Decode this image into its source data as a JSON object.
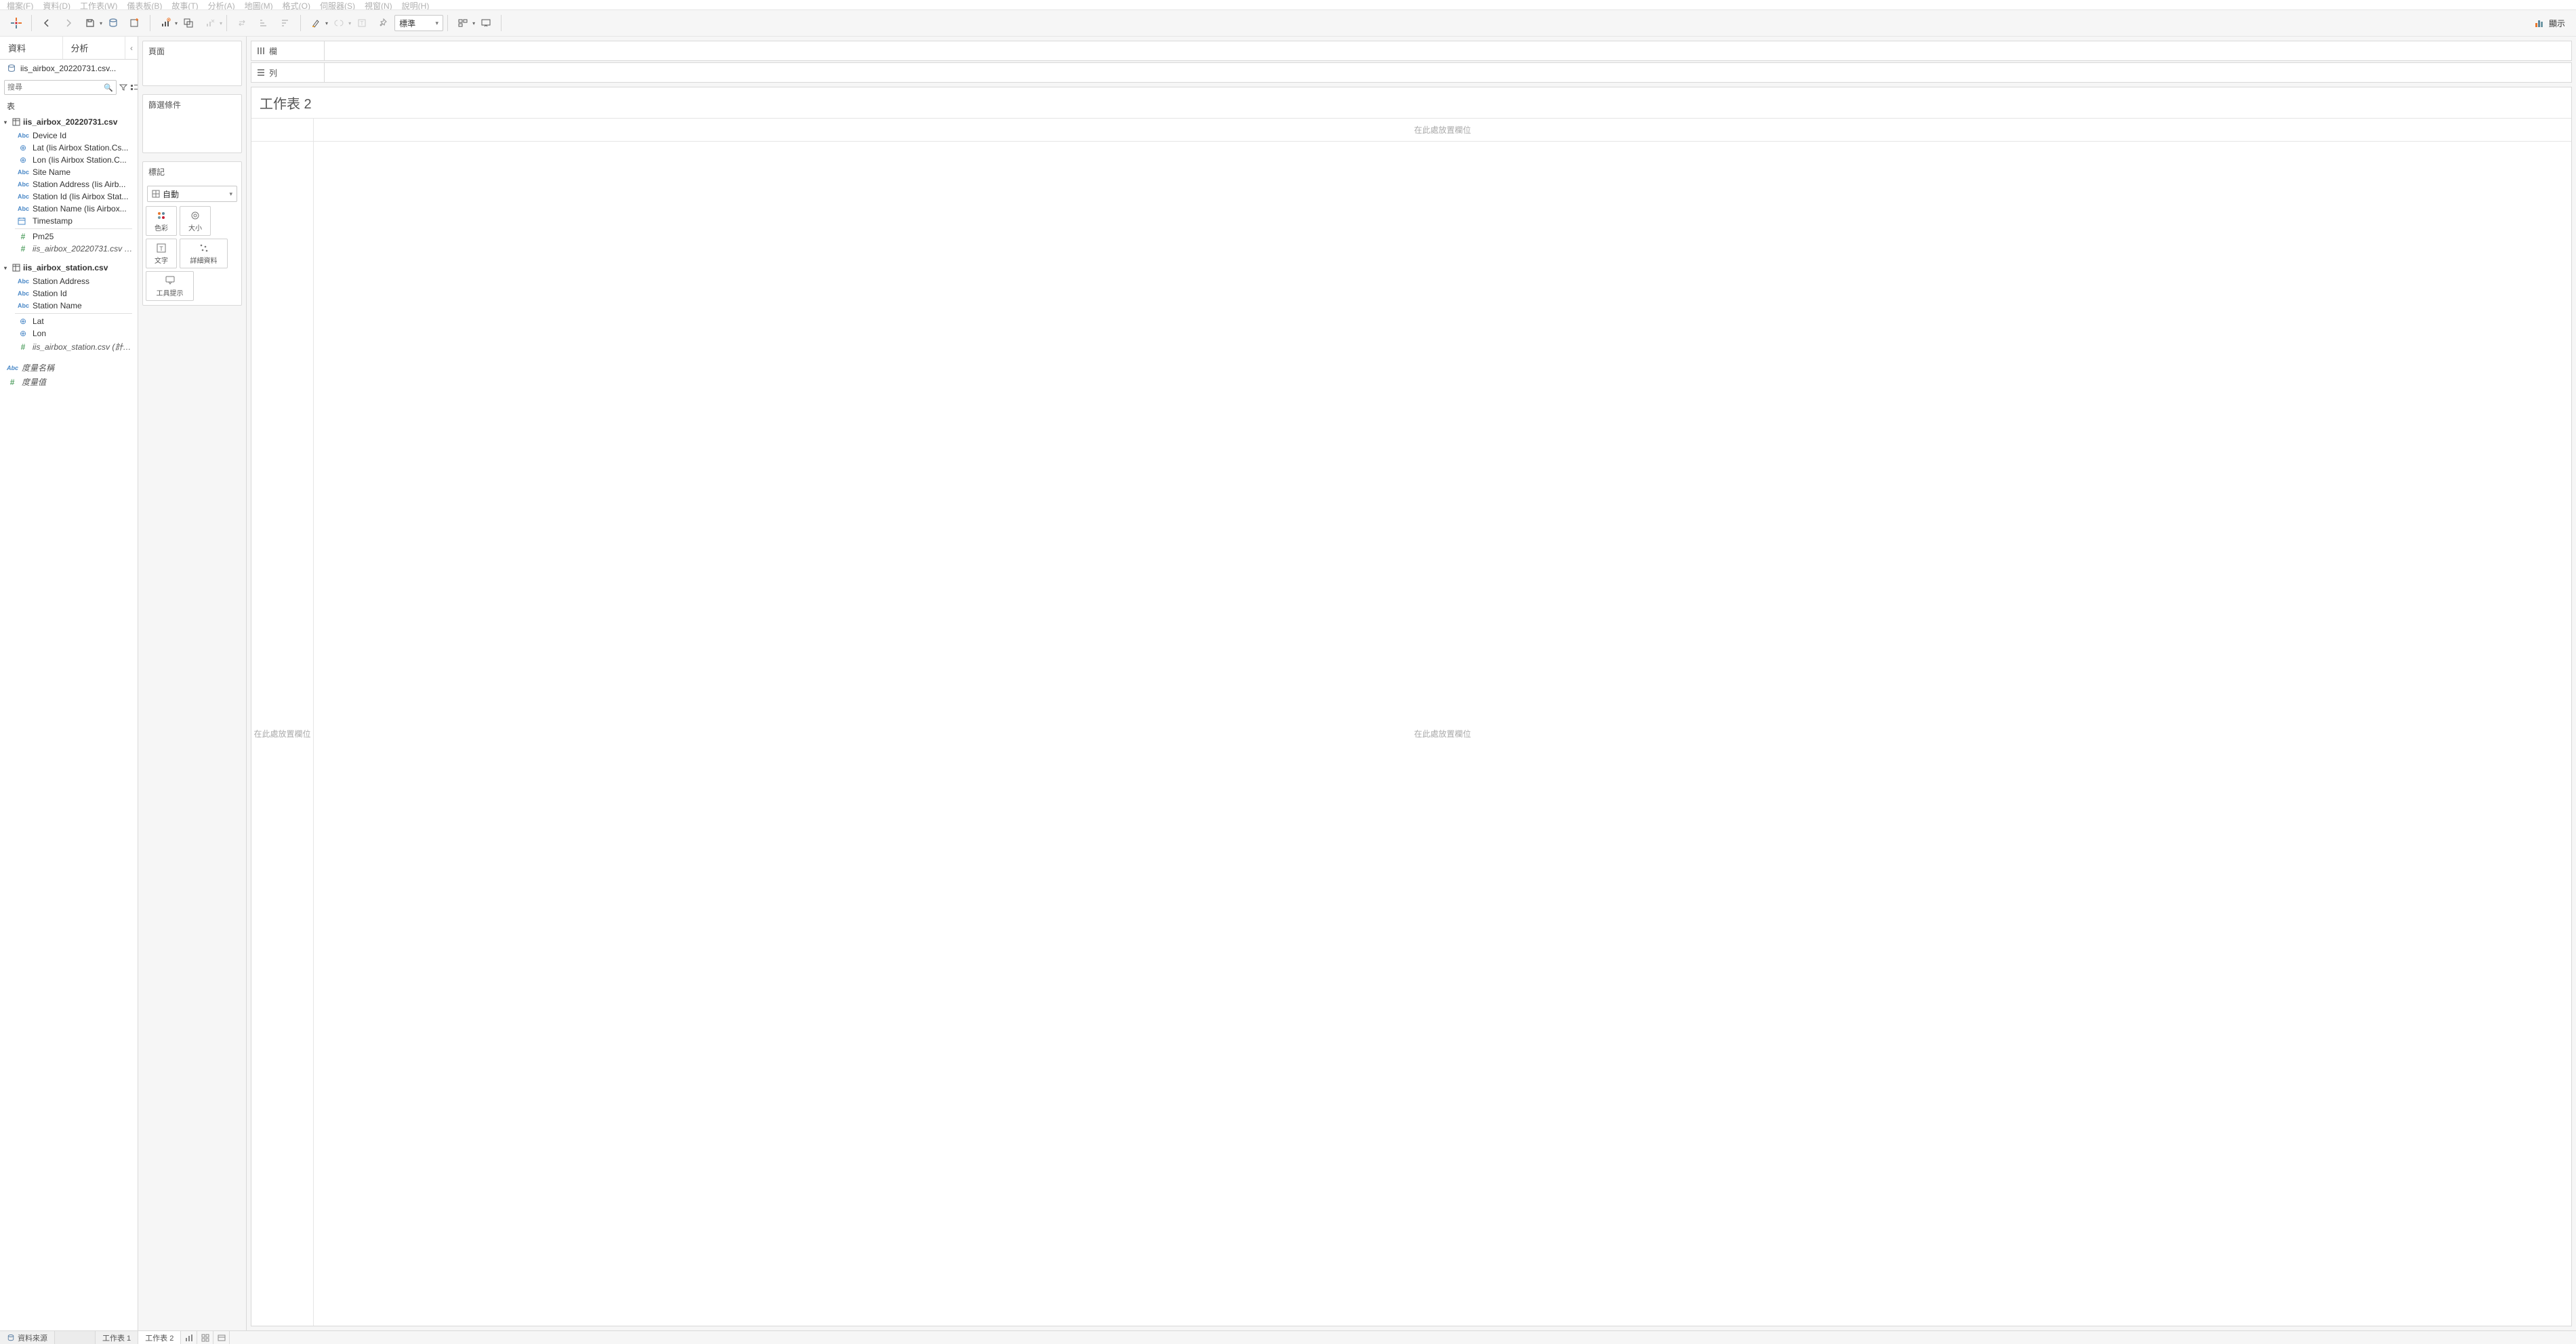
{
  "menu": [
    "檔案(F)",
    "資料(D)",
    "工作表(W)",
    "儀表板(B)",
    "故事(T)",
    "分析(A)",
    "地圖(M)",
    "格式(O)",
    "伺服器(S)",
    "視窗(N)",
    "說明(H)"
  ],
  "toolbar": {
    "fit_dropdown": "標準",
    "show_me": "顯示"
  },
  "sidebar": {
    "tab_data": "資料",
    "tab_analytics": "分析",
    "datasource": "iis_airbox_20220731.csv...",
    "search_placeholder": "搜尋",
    "tables_label": "表",
    "groups": [
      {
        "name": "iis_airbox_20220731.csv",
        "fields": [
          {
            "type": "abc",
            "label": "Device Id"
          },
          {
            "type": "globe",
            "label": "Lat (Iis Airbox Station.Cs..."
          },
          {
            "type": "globe",
            "label": "Lon (Iis Airbox Station.C..."
          },
          {
            "type": "abc",
            "label": "Site Name"
          },
          {
            "type": "abc",
            "label": "Station Address (Iis Airb..."
          },
          {
            "type": "abc",
            "label": "Station Id (Iis Airbox Stat..."
          },
          {
            "type": "abc",
            "label": "Station Name (Iis Airbox..."
          },
          {
            "type": "date",
            "label": "Timestamp"
          },
          {
            "type": "num",
            "label": "Pm25"
          },
          {
            "type": "num",
            "label": "iis_airbox_20220731.csv (...",
            "italic": true
          }
        ]
      },
      {
        "name": "iis_airbox_station.csv",
        "fields": [
          {
            "type": "abc",
            "label": "Station Address"
          },
          {
            "type": "abc",
            "label": "Station Id"
          },
          {
            "type": "abc",
            "label": "Station Name"
          },
          {
            "type": "globe",
            "label": "Lat"
          },
          {
            "type": "globe",
            "label": "Lon"
          },
          {
            "type": "num",
            "label": "iis_airbox_station.csv (計數)",
            "italic": true
          }
        ]
      }
    ],
    "measure_names": "度量名稱",
    "measure_values": "度量值"
  },
  "shelves": {
    "pages": "頁面",
    "filters": "篩選條件",
    "marks": "標記",
    "mark_type": "自動",
    "color": "色彩",
    "size": "大小",
    "text": "文字",
    "detail": "詳細資料",
    "tooltip": "工具提示"
  },
  "rowcol": {
    "columns": "欄",
    "rows": "列"
  },
  "sheet": {
    "title": "工作表 2",
    "drop_hint": "在此處放置欄位"
  },
  "bottom": {
    "datasource": "資料來源",
    "sheet1": "工作表 1",
    "sheet2": "工作表 2"
  }
}
